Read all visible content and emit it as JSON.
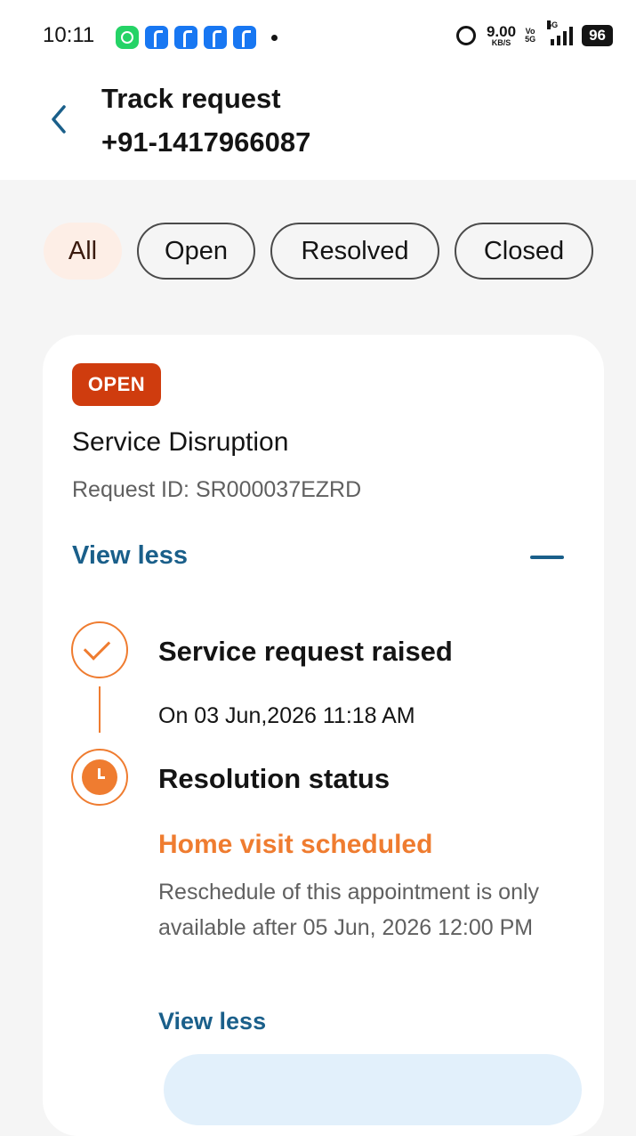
{
  "status_bar": {
    "time": "10:11",
    "app_icons": [
      "whatsapp-icon",
      "facebook-icon",
      "facebook-icon",
      "facebook-icon",
      "facebook-icon"
    ],
    "net_speed_value": "9.00",
    "net_speed_unit": "KB/S",
    "volte_top": "Vo",
    "volte_bottom": "5G",
    "signal_label": "5G",
    "battery": "96"
  },
  "header": {
    "title": "Track request",
    "phone_number": "+91-1417966087"
  },
  "filters": [
    {
      "label": "All",
      "active": true
    },
    {
      "label": "Open",
      "active": false
    },
    {
      "label": "Resolved",
      "active": false
    },
    {
      "label": "Closed",
      "active": false
    }
  ],
  "request_card": {
    "badge": "OPEN",
    "title": "Service Disruption",
    "request_id": "Request ID: SR000037EZRD",
    "toggle_label": "View less",
    "steps": [
      {
        "title": "Service request raised",
        "date": "On 03 Jun,2026 11:18 AM"
      },
      {
        "title": "Resolution status",
        "status": "Home visit scheduled",
        "description": "Reschedule of this appointment is only available after 05 Jun, 2026 12:00 PM",
        "toggle_label": "View less"
      }
    ]
  },
  "colors": {
    "accent_orange": "#ef7c30",
    "badge_red": "#cf3c0e",
    "link_blue": "#1a5f8a",
    "chip_active_bg": "#fdeee6"
  }
}
